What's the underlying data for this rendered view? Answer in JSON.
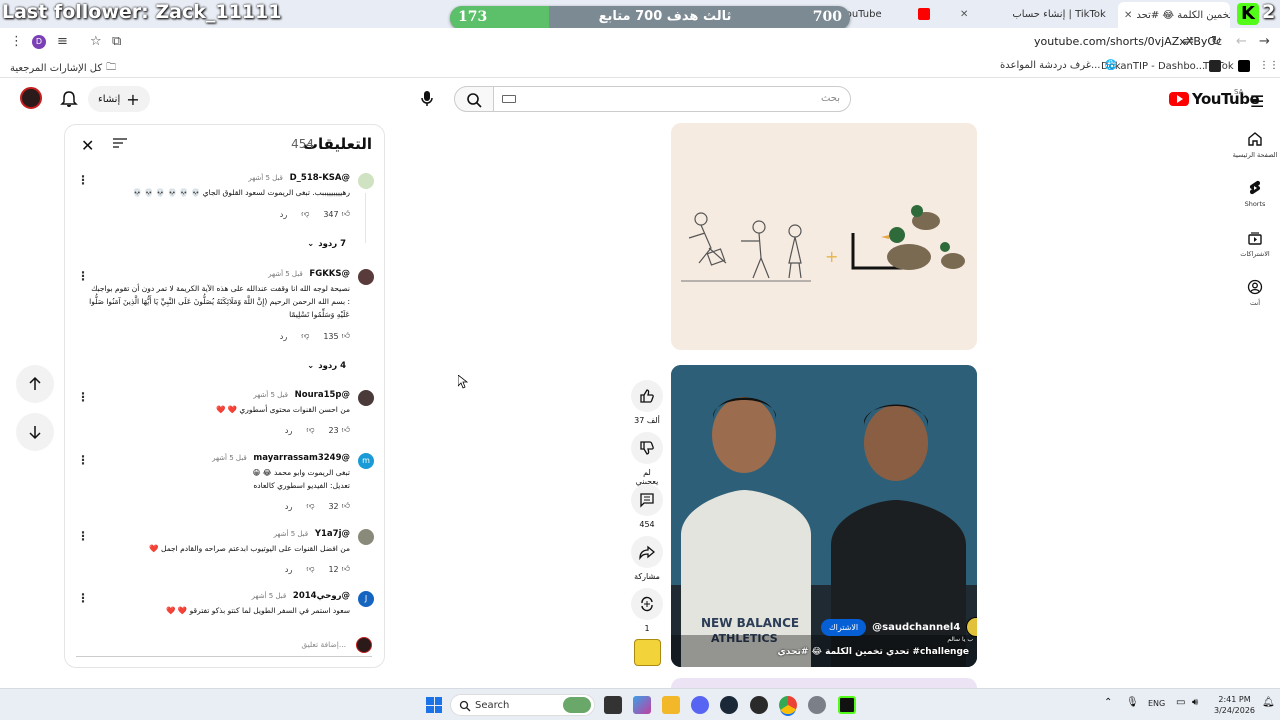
{
  "overlay": {
    "follower_text": "Last follower: Zack_11111",
    "kick_letter": "K",
    "kick_number": "2",
    "goal_current": "173",
    "goal_target": "700",
    "goal_label": "ثالث هدف 700 متابع",
    "goal_progress": 0.247
  },
  "browser": {
    "tabs": [
      {
        "title": "تحدي تخمين الكلمة 😂 #تحد",
        "close": "✕"
      },
      {
        "title": "إنشاء حساب | TikTok",
        "close": "✕"
      },
      {
        "title": "",
        "close": "✕"
      },
      {
        "title": "(6) tik... YouTube",
        "close": "✕"
      },
      {
        "title": "+",
        "close": ""
      }
    ],
    "url": "youtube.com/shorts/0vjAZxXByOc",
    "bookmarks": [
      {
        "label": "TikTok"
      },
      {
        "label": "DokanTIP - Dashbo..."
      },
      {
        "label": "غرف دردشة المواعدة..."
      },
      {
        "label": "كل الإشارات المرجعية"
      }
    ]
  },
  "youtube": {
    "logo_text": "YouTube",
    "country_code": "SA",
    "search_placeholder": "بحث",
    "create_label": "إنشاء",
    "nav": [
      {
        "label": "الصفحة الرئيسية",
        "icon": "home-icon"
      },
      {
        "label": "Shorts",
        "icon": "shorts-icon"
      },
      {
        "label": "الاشتراكات",
        "icon": "subscriptions-icon"
      },
      {
        "label": "أنت",
        "icon": "you-icon"
      }
    ],
    "actions": {
      "likes": "37 ألف",
      "dislike_label": "لم يعجبني",
      "comments": "454",
      "share_label": "مشاركة",
      "remix": "1"
    },
    "short": {
      "channel": "@saudchannel4",
      "subscribe_label": "الاشتراك",
      "subtitle": "ب يا سالم",
      "caption": "تحدي تخمين الكلمة 😂 #تحدي #challenge"
    }
  },
  "comments_panel": {
    "title": "التعليقات",
    "count": "454",
    "add_comment_placeholder": "إضافة تعليق...",
    "reply_label": "رد",
    "items": [
      {
        "author": "@D_518-KSA",
        "time": "قبل 5 أشهر",
        "text": "رهيييييييببب. تبغى الريموت لسعود القلوق الجاي 💀 💀 💀 💀 💀 💀",
        "likes": "347",
        "replies": "7 ردود",
        "avatar_color": "#cfe3c2"
      },
      {
        "author": "@FGKKS",
        "time": "قبل 5 أشهر",
        "text": "نصيحة لوجه الله انا وقفت عندالله على هذه الآية الكريمة لا تمر دون أن تقوم بواجبك : بسم الله الرحمن الرحيم (إِنَّ اللَّهَ وَمَلَائِكَتَهُ يُصَلُّونَ عَلَى النَّبِيِّ يَا أَيُّهَا الَّذِينَ آمَنُوا صَلُّوا عَلَيْهِ وَسَلِّمُوا تَسْلِيمًا",
        "likes": "135",
        "replies": "4 ردود",
        "avatar_color": "#5a3b3b"
      },
      {
        "author": "@Noura15p",
        "time": "قبل 5 أشهر",
        "text": "من احسن القنوات محتوى أسطوري ❤️ ❤️",
        "likes": "23",
        "replies": "",
        "avatar_color": "#4a3a3a"
      },
      {
        "author": "@mayarrassam3249",
        "time": "قبل 5 أشهر",
        "text": "تبغى الريموت وابو محمد 😂 😁\nتعديل: الفيديو اسطوري كالعاده",
        "likes": "32",
        "replies": "",
        "avatar_color": "#1a9ad6",
        "avatar_letter": "m"
      },
      {
        "author": "@Y1a7j",
        "time": "قبل 5 أشهر",
        "text": "من افضل القنوات على اليوتيوب ابدعتم صراحه والقادم اجمل ❤️",
        "likes": "12",
        "replies": "",
        "avatar_color": "#8a8a7a"
      },
      {
        "author": "@روحي2014",
        "time": "قبل 5 أشهر",
        "text": "سعود استمر في السفر الطويل لما كنتو بذكو تفترقو ❤️ ❤️",
        "likes": "",
        "replies": "",
        "avatar_color": "#1565c0",
        "avatar_letter": "J"
      }
    ]
  },
  "taskbar": {
    "search_label": "Search",
    "lang": "ENG",
    "time": "2:41 PM",
    "date": "3/24/2026"
  },
  "colors": {
    "youtube_red": "#ff0000",
    "subscribe_blue": "#065fd4",
    "goal_green": "#5cc06a",
    "kick_green": "#53fc18"
  }
}
